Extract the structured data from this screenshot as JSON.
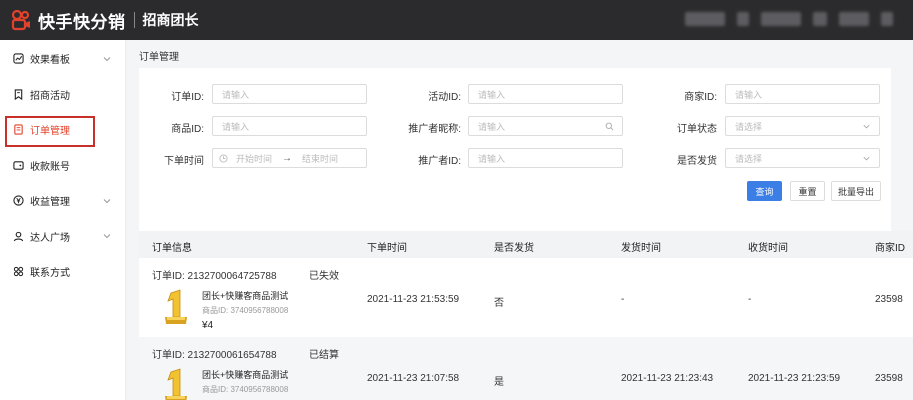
{
  "topbar": {
    "brand": "快手快分销",
    "sub": "招商团长",
    "bg_color": "#2b2b2e",
    "brand_color": "#e2422c"
  },
  "sidebar": {
    "items": [
      {
        "label": "效果看板",
        "icon": "chart-icon",
        "has_chevron": true
      },
      {
        "label": "招商活动",
        "icon": "bookmark-icon",
        "has_chevron": false
      },
      {
        "label": "订单管理",
        "icon": "order-icon",
        "has_chevron": false,
        "active": true
      },
      {
        "label": "收款账号",
        "icon": "wallet-icon",
        "has_chevron": false
      },
      {
        "label": "收益管理",
        "icon": "income-icon",
        "has_chevron": true
      },
      {
        "label": "达人广场",
        "icon": "user-icon",
        "has_chevron": true
      },
      {
        "label": "联系方式",
        "icon": "grid-icon",
        "has_chevron": false
      }
    ]
  },
  "breadcrumb": "订单管理",
  "filters": {
    "order_id": {
      "label": "订单ID:",
      "placeholder": "请输入"
    },
    "activity_id": {
      "label": "活动ID:",
      "placeholder": "请输入"
    },
    "merchant_id": {
      "label": "商家ID:",
      "placeholder": "请输入"
    },
    "product_id": {
      "label": "商品ID:",
      "placeholder": "请输入"
    },
    "promoter_nick": {
      "label": "推广者昵称:",
      "placeholder": "请输入"
    },
    "order_status": {
      "label": "订单状态",
      "placeholder": "请选择"
    },
    "order_time": {
      "label": "下单时间",
      "start": "开始时间",
      "end": "结束时间"
    },
    "promoter_id": {
      "label": "推广者ID:",
      "placeholder": "请输入"
    },
    "shipped": {
      "label": "是否发货",
      "placeholder": "请选择"
    }
  },
  "buttons": {
    "query": "查询",
    "reset": "重置",
    "export": "批量导出"
  },
  "table": {
    "columns": [
      "订单信息",
      "下单时间",
      "是否发货",
      "发货时间",
      "收货时间",
      "商家ID"
    ],
    "rows": [
      {
        "order_id": "订单ID: 2132700064725788",
        "status": "已失效",
        "product_name": "团长+快赚客商品测试",
        "product_id": "商品ID: 3740956788008",
        "price": "¥4",
        "order_time": "2021-11-23 21:53:59",
        "shipped": "否",
        "ship_time": "-",
        "receive_time": "-",
        "merchant_id": "23598"
      },
      {
        "order_id": "订单ID: 2132700061654788",
        "status": "已结算",
        "product_name": "团长+快赚客商品测试",
        "product_id": "商品ID: 3740956788008",
        "price": "¥4",
        "order_time": "2021-11-23 21:07:58",
        "shipped": "是",
        "ship_time": "2021-11-23 21:23:43",
        "receive_time": "2021-11-23 21:23:59",
        "merchant_id": "23598"
      }
    ]
  }
}
